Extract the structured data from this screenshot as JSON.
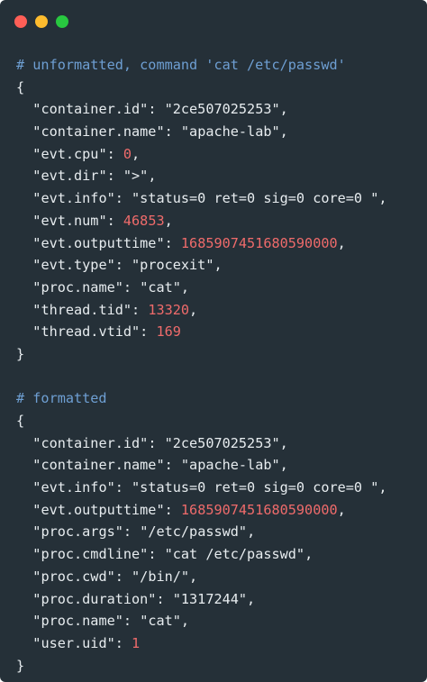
{
  "window": {
    "controls": [
      {
        "name": "close",
        "color": "#ff5f57"
      },
      {
        "name": "minimize",
        "color": "#febc2e"
      },
      {
        "name": "maximize",
        "color": "#28c840"
      }
    ]
  },
  "colors": {
    "background": "#253038",
    "text": "#e7ecef",
    "comment": "#6e9fd3",
    "number": "#ef6b6b"
  },
  "blocks": [
    {
      "comment": "# unformatted, command 'cat /etc/passwd'",
      "open": "{",
      "close": "}",
      "lines": [
        {
          "key": "\"container.id\"",
          "value": "\"2ce507025253\"",
          "kind": "str",
          "comma": ","
        },
        {
          "key": "\"container.name\"",
          "value": "\"apache-lab\"",
          "kind": "str",
          "comma": ","
        },
        {
          "key": "\"evt.cpu\"",
          "value": "0",
          "kind": "num",
          "comma": ","
        },
        {
          "key": "\"evt.dir\"",
          "value": "\">\"",
          "kind": "str",
          "comma": ","
        },
        {
          "key": "\"evt.info\"",
          "value": "\"status=0 ret=0 sig=0 core=0 \"",
          "kind": "str",
          "comma": ","
        },
        {
          "key": "\"evt.num\"",
          "value": "46853",
          "kind": "num",
          "comma": ","
        },
        {
          "key": "\"evt.outputtime\"",
          "value": "1685907451680590000",
          "kind": "num",
          "comma": ","
        },
        {
          "key": "\"evt.type\"",
          "value": "\"procexit\"",
          "kind": "str",
          "comma": ","
        },
        {
          "key": "\"proc.name\"",
          "value": "\"cat\"",
          "kind": "str",
          "comma": ","
        },
        {
          "key": "\"thread.tid\"",
          "value": "13320",
          "kind": "num",
          "comma": ","
        },
        {
          "key": "\"thread.vtid\"",
          "value": "169",
          "kind": "num",
          "comma": ""
        }
      ]
    },
    {
      "comment": "# formatted",
      "open": "{",
      "close": "}",
      "lines": [
        {
          "key": "\"container.id\"",
          "value": "\"2ce507025253\"",
          "kind": "str",
          "comma": ","
        },
        {
          "key": "\"container.name\"",
          "value": "\"apache-lab\"",
          "kind": "str",
          "comma": ","
        },
        {
          "key": "\"evt.info\"",
          "value": "\"status=0 ret=0 sig=0 core=0 \"",
          "kind": "str",
          "comma": ","
        },
        {
          "key": "\"evt.outputtime\"",
          "value": "1685907451680590000",
          "kind": "num",
          "comma": ","
        },
        {
          "key": "\"proc.args\"",
          "value": "\"/etc/passwd\"",
          "kind": "str",
          "comma": ","
        },
        {
          "key": "\"proc.cmdline\"",
          "value": "\"cat /etc/passwd\"",
          "kind": "str",
          "comma": ","
        },
        {
          "key": "\"proc.cwd\"",
          "value": "\"/bin/\"",
          "kind": "str",
          "comma": ","
        },
        {
          "key": "\"proc.duration\"",
          "value": "\"1317244\"",
          "kind": "str",
          "comma": ","
        },
        {
          "key": "\"proc.name\"",
          "value": "\"cat\"",
          "kind": "str",
          "comma": ","
        },
        {
          "key": "\"user.uid\"",
          "value": "1",
          "kind": "num",
          "comma": ""
        }
      ]
    }
  ]
}
